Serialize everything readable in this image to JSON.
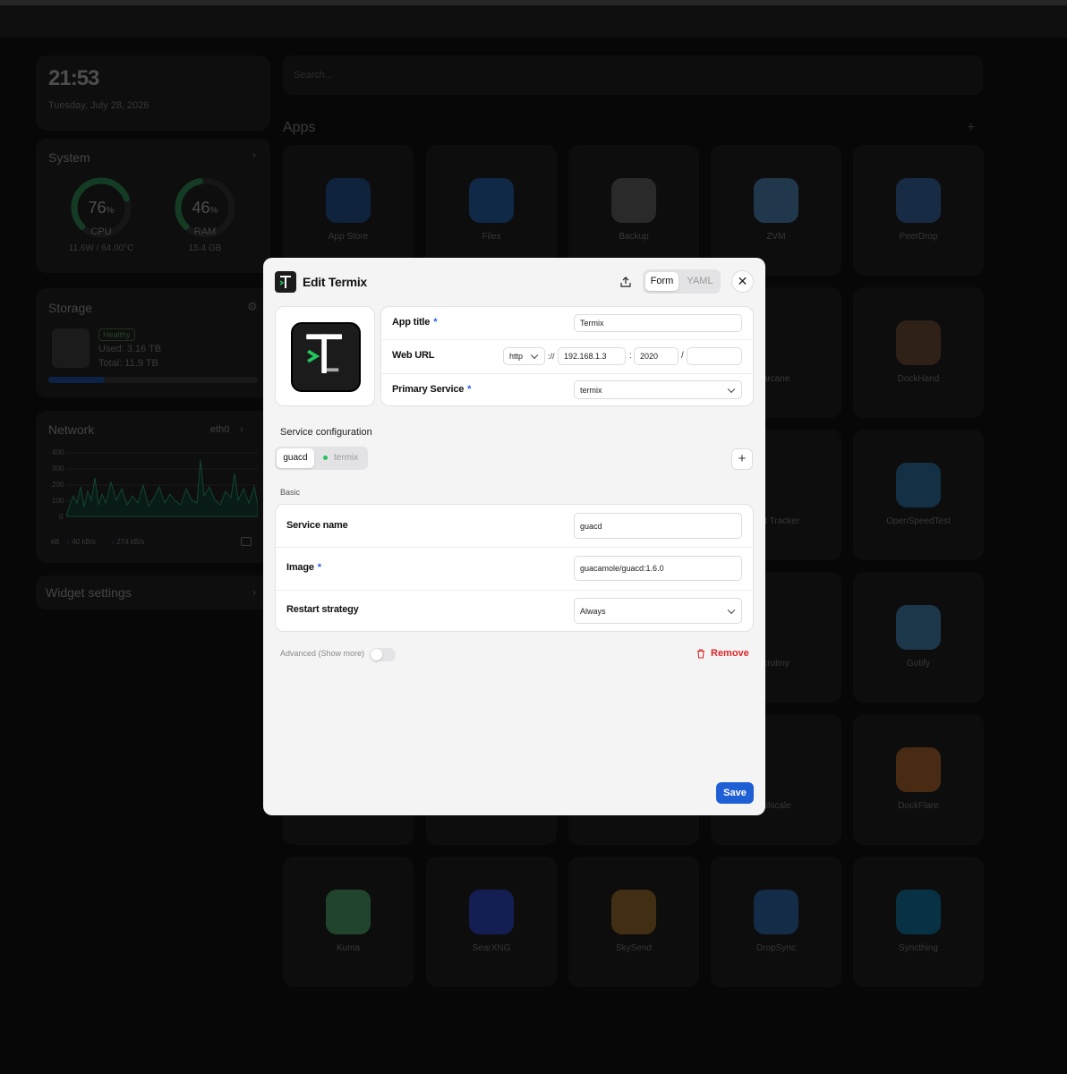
{
  "dashboard": {
    "clock": {
      "time": "21:53",
      "date": "Tuesday, July 28, 2026"
    },
    "system": {
      "title": "System",
      "cpu": {
        "value": "76",
        "unit": "%",
        "label": "CPU",
        "detail": "11.6W / 64.00°C",
        "percent": 76
      },
      "ram": {
        "value": "46",
        "unit": "%",
        "label": "RAM",
        "detail": "15.4 GB",
        "percent": 46
      }
    },
    "storage": {
      "title": "Storage",
      "status": "Healthy",
      "used": "Used: 3.16 TB",
      "total": "Total: 11.9 TB",
      "fill_fraction": 0.27
    },
    "network": {
      "title": "Network",
      "interface": "eth0",
      "y_ticks": [
        "400",
        "300",
        "200",
        "100",
        "0"
      ],
      "unit": "kB",
      "up": "40 kB/s",
      "down": "274 kB/s"
    },
    "widget_settings": "Widget settings"
  },
  "search": {
    "placeholder": "Search..."
  },
  "apps": {
    "title": "Apps",
    "add": "+",
    "tiles": [
      {
        "label": "App Store",
        "color": "#1d5fb8"
      },
      {
        "label": "Files",
        "color": "#1a73d9"
      },
      {
        "label": "Backup",
        "color": "#777777"
      },
      {
        "label": "ZVM",
        "color": "#5aa3e6"
      },
      {
        "label": "PeerDrop",
        "color": "#3a7bd5"
      },
      {
        "label": "DockHand",
        "color": "#8a5a3a"
      },
      {
        "label": "OpenSpeedTest",
        "color": "#2a8fd1"
      },
      {
        "label": "Gotify",
        "color": "#4aa3df"
      },
      {
        "label": "DockFlare",
        "color": "#e07a2a"
      },
      {
        "label": "Kuma",
        "color": "#5cd27f"
      },
      {
        "label": "SearXNG",
        "color": "#3050ff"
      },
      {
        "label": "SkySend",
        "color": "#c98a2a"
      },
      {
        "label": "DropSync",
        "color": "#2f7fd9"
      },
      {
        "label": "Syncthing",
        "color": "#0891d1"
      }
    ],
    "partial_labels": [
      "arcane",
      "test Tracker",
      "crutiny",
      "ailscale"
    ]
  },
  "modal": {
    "title": "Edit Termix",
    "mode_tabs": {
      "form": "Form",
      "yaml": "YAML",
      "active": "Form"
    },
    "close": "✕",
    "fields": {
      "app_title": {
        "label": "App title",
        "required": "*",
        "value": "Termix"
      },
      "web_url": {
        "label": "Web URL",
        "scheme": "http",
        "scheme_sep": "://",
        "host": "192.168.1.3",
        "port_sep": ":",
        "port": "2020",
        "path_sep": "/",
        "path": ""
      },
      "primary_service": {
        "label": "Primary Service",
        "required": "*",
        "value": "termix"
      }
    },
    "service_config": {
      "title": "Service configuration",
      "tabs": [
        {
          "label": "guacd",
          "active": true
        },
        {
          "label": "termix",
          "active": false,
          "status_color": "#22c55e"
        }
      ],
      "add": "+",
      "section": "Basic",
      "service_name": {
        "label": "Service name",
        "value": "guacd"
      },
      "image": {
        "label": "Image",
        "required": "*",
        "value": "guacamole/guacd:1.6.0"
      },
      "restart_strategy": {
        "label": "Restart strategy",
        "value": "Always"
      },
      "advanced": {
        "label": "Advanced (Show more)",
        "enabled": false
      },
      "remove": "Remove"
    },
    "save": "Save",
    "accent_color": "#1f5fd6",
    "danger_color": "#dc2626"
  }
}
